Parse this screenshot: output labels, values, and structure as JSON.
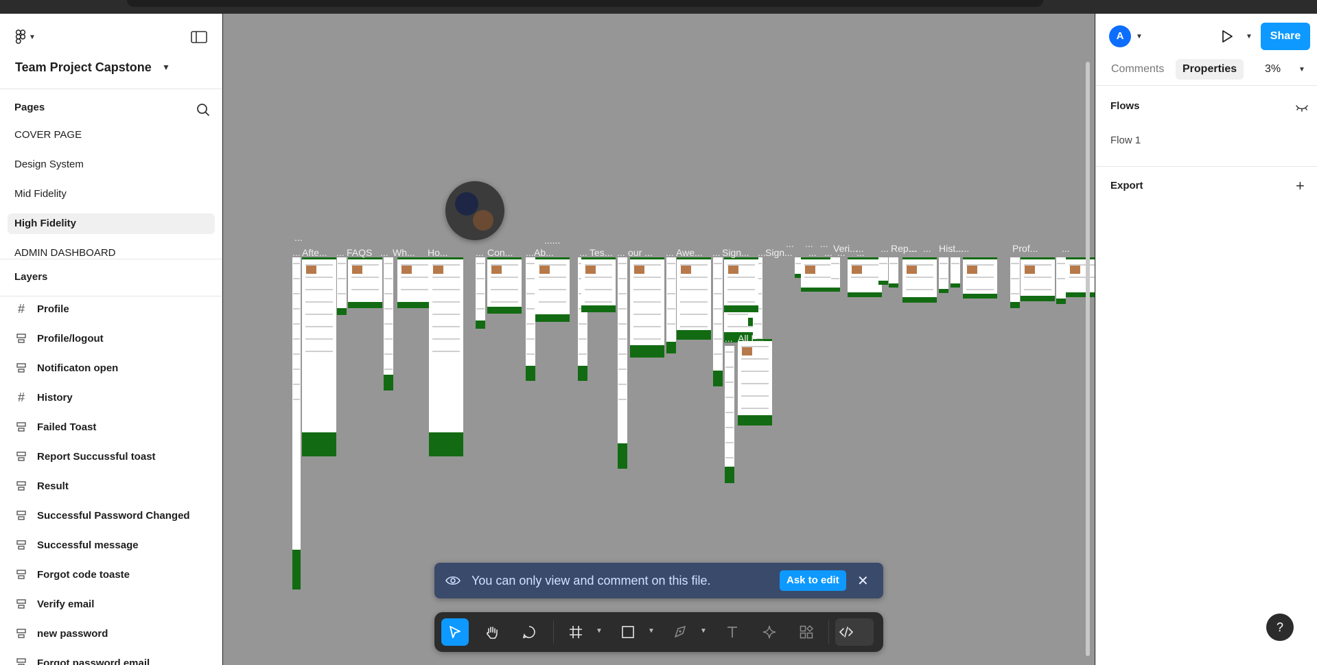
{
  "app": {
    "file_title": "Team Project Capstone"
  },
  "pages": {
    "title": "Pages",
    "items": [
      {
        "label": "COVER PAGE",
        "active": false
      },
      {
        "label": "Design System",
        "active": false
      },
      {
        "label": "Mid Fidelity",
        "active": false
      },
      {
        "label": "High Fidelity",
        "active": true
      },
      {
        "label": "ADMIN DASHBOARD",
        "active": false
      }
    ]
  },
  "layers": {
    "title": "Layers",
    "items": [
      {
        "label": "Profile",
        "icon": "frame-icon"
      },
      {
        "label": "Profile/logout",
        "icon": "autolayout-icon"
      },
      {
        "label": "Notificaton open",
        "icon": "autolayout-icon"
      },
      {
        "label": "History",
        "icon": "frame-icon"
      },
      {
        "label": "Failed Toast",
        "icon": "autolayout-icon"
      },
      {
        "label": "Report Succussful toast",
        "icon": "autolayout-icon"
      },
      {
        "label": "Result",
        "icon": "autolayout-icon"
      },
      {
        "label": "Successful Password Changed",
        "icon": "autolayout-icon"
      },
      {
        "label": "Successful message",
        "icon": "autolayout-icon"
      },
      {
        "label": "Forgot code toaste",
        "icon": "autolayout-icon"
      },
      {
        "label": "Verify email",
        "icon": "autolayout-icon"
      },
      {
        "label": "new password",
        "icon": "autolayout-icon"
      },
      {
        "label": "Forgot password email",
        "icon": "autolayout-icon"
      }
    ]
  },
  "canvas": {
    "frame_labels": [
      "...",
      "...",
      "Afte...",
      "...",
      "FAQS",
      "...",
      "Wh...",
      "Ho...",
      "...",
      "Con...",
      "...",
      "Ab...",
      "......",
      "...",
      "Tes...",
      "...",
      "our ...",
      "...",
      "Awe...",
      "...",
      "Sign...",
      "...",
      "Sign...",
      "...",
      "...",
      "...",
      "...",
      "...",
      "...",
      "...",
      "Veri...",
      "...",
      "...",
      "Rep...",
      "...",
      "...",
      "Hist...",
      ".......",
      "Prof...",
      "...",
      "...",
      "All F..."
    ]
  },
  "toast": {
    "message": "You can only view and comment on this file.",
    "action_label": "Ask to edit"
  },
  "toolbar": {
    "tools": [
      "move-tool",
      "hand-tool",
      "comment-tool",
      "frame-tool",
      "rectangle-tool",
      "pen-tool",
      "text-tool",
      "actions-tool",
      "components-tool",
      "dev-mode-toggle"
    ]
  },
  "right_panel": {
    "user_initial": "A",
    "share_label": "Share",
    "tab_comments": "Comments",
    "tab_properties": "Properties",
    "zoom": "3%",
    "flows_title": "Flows",
    "flows": [
      "Flow 1"
    ],
    "export_title": "Export",
    "help_label": "?"
  },
  "colors": {
    "accent": "#0d99ff",
    "canvas_bg": "#969696",
    "frame_green": "#126b12",
    "toast_bg": "#3a4a6b"
  }
}
